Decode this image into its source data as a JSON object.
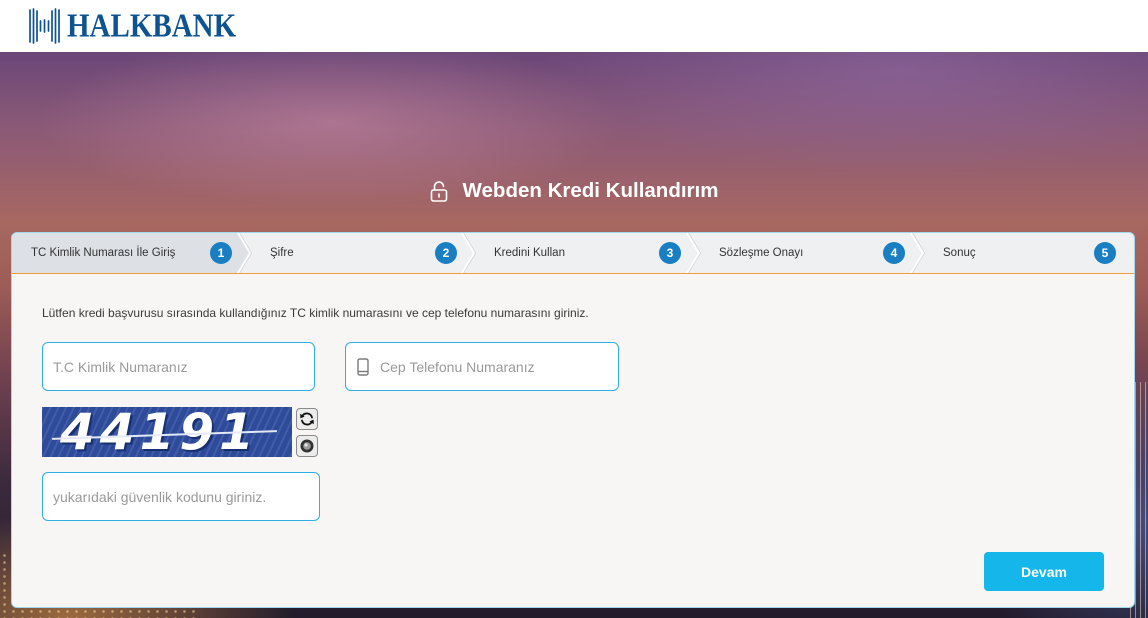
{
  "header": {
    "logo_text": "HALKBANK",
    "logo_icon": "halkbank-logo-icon"
  },
  "hero": {
    "title": "Webden Kredi Kullandırım",
    "title_icon": "unlock-icon"
  },
  "steps": [
    {
      "number": "1",
      "label": "TC Kimlik Numarası İle Giriş",
      "active": true
    },
    {
      "number": "2",
      "label": "Şifre",
      "active": false
    },
    {
      "number": "3",
      "label": "Kredini Kullan",
      "active": false
    },
    {
      "number": "4",
      "label": "Sözleşme Onayı",
      "active": false
    },
    {
      "number": "5",
      "label": "Sonuç",
      "active": false
    }
  ],
  "form": {
    "instruction": "Lütfen kredi başvurusu sırasında kullandığınız TC kimlik numarasını ve cep telefonu numarasını giriniz.",
    "tc_kimlik": {
      "placeholder": "T.C Kimlik Numaranız"
    },
    "phone": {
      "placeholder": "Cep Telefonu Numaranız",
      "icon": "mobile-phone-icon"
    },
    "captcha": {
      "code": "44191",
      "refresh_icon": "refresh-icon",
      "audio_icon": "audio-icon",
      "placeholder": "yukarıdaki güvenlik kodunu giriniz."
    },
    "submit_label": "Devam"
  },
  "colors": {
    "brand_navy": "#0d5291",
    "step_circle": "#1a7fc2",
    "active_step_bg": "#dde1e6",
    "progress_line": "#f29c38",
    "input_border": "#2eaee3",
    "submit_button": "#15b6ea"
  }
}
